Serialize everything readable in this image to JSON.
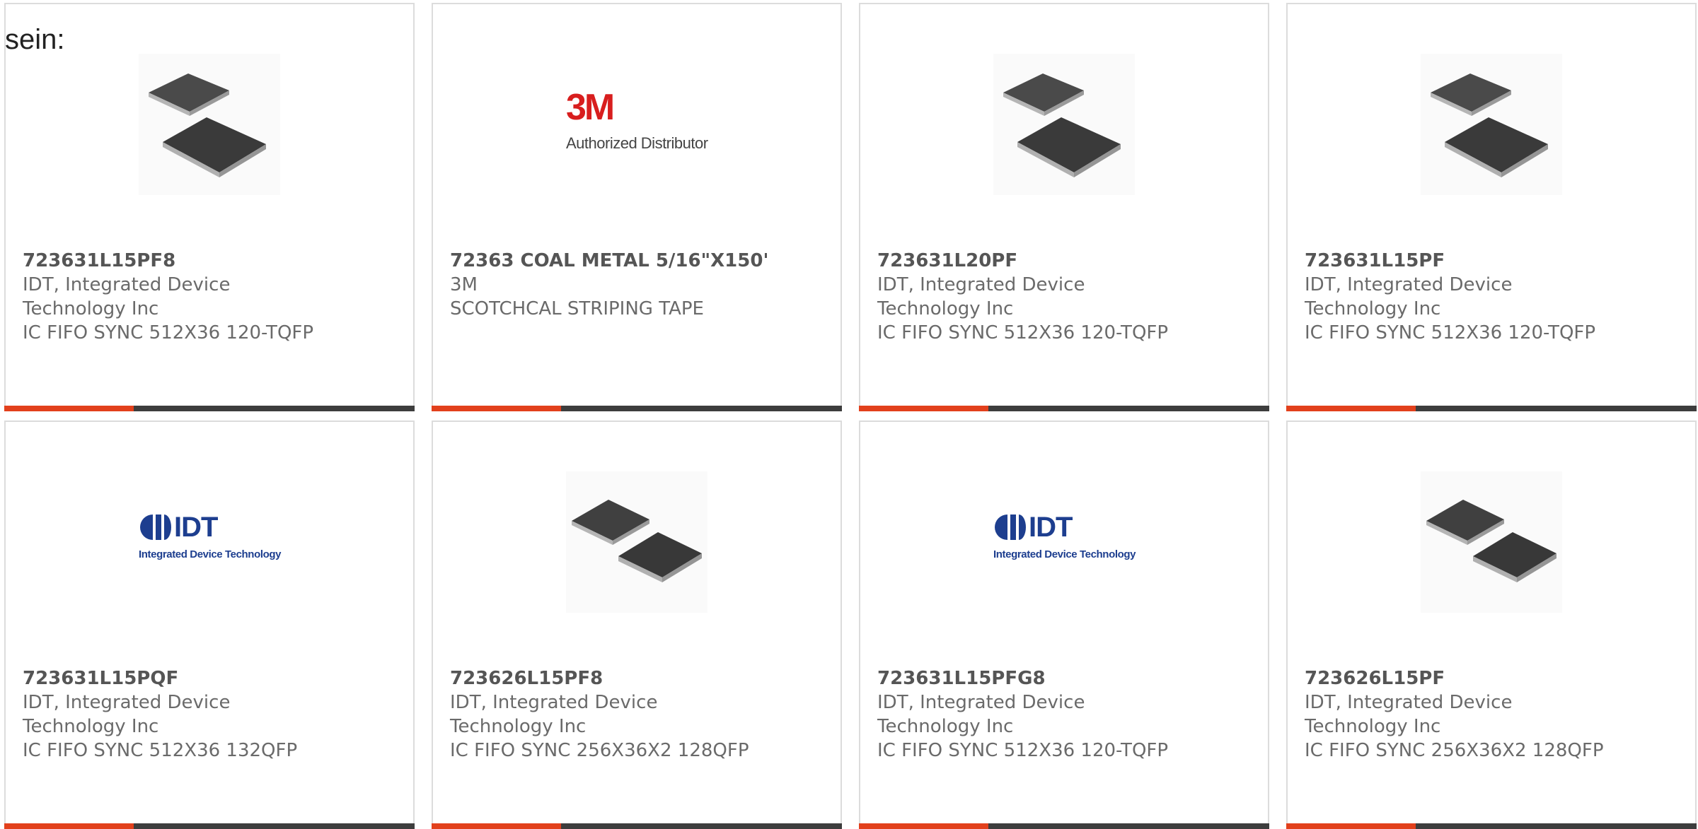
{
  "page": {
    "label": "sein:"
  },
  "products": [
    {
      "part_number": "723631L15PF8",
      "manufacturer": "IDT, Integrated Device Technology Inc",
      "description": "IC FIFO SYNC 512X36 120-TQFP",
      "image": "chip-package-image",
      "image_variant": "stacked"
    },
    {
      "part_number": "72363 COAL METAL 5/16\"X150'",
      "manufacturer": "3M",
      "description": "SCOTCHCAL STRIPING TAPE",
      "image": "3m-logo",
      "logo_text": "3M",
      "logo_subtext": "Authorized Distributor"
    },
    {
      "part_number": "723631L20PF",
      "manufacturer": "IDT, Integrated Device Technology Inc",
      "description": "IC FIFO SYNC 512X36 120-TQFP",
      "image": "chip-package-image",
      "image_variant": "stacked"
    },
    {
      "part_number": "723631L15PF",
      "manufacturer": "IDT, Integrated Device Technology Inc",
      "description": "IC FIFO SYNC 512X36 120-TQFP",
      "image": "chip-package-image",
      "image_variant": "stacked"
    },
    {
      "part_number": "723631L15PQF",
      "manufacturer": "IDT, Integrated Device Technology Inc",
      "description": "IC FIFO SYNC 512X36 132QFP",
      "image": "idt-logo",
      "logo_text": "IDT",
      "logo_subtext": "Integrated Device Technology"
    },
    {
      "part_number": "723626L15PF8",
      "manufacturer": "IDT, Integrated Device Technology Inc",
      "description": "IC FIFO SYNC 256X36X2 128QFP",
      "image": "chip-package-image",
      "image_variant": "side-by-side"
    },
    {
      "part_number": "723631L15PFG8",
      "manufacturer": "IDT, Integrated Device Technology Inc",
      "description": "IC FIFO SYNC 512X36 120-TQFP",
      "image": "idt-logo",
      "logo_text": "IDT",
      "logo_subtext": "Integrated Device Technology"
    },
    {
      "part_number": "723626L15PF",
      "manufacturer": "IDT, Integrated Device Technology Inc",
      "description": "IC FIFO SYNC 256X36X2 128QFP",
      "image": "chip-package-image",
      "image_variant": "side-by-side"
    }
  ],
  "colors": {
    "accent": "#e2401c",
    "bar": "#3d3d3d",
    "border": "#dcdcdc",
    "text": "#6a6a6a",
    "title": "#555555",
    "brand_3m": "#d81e1e",
    "brand_idt": "#1d3e8f"
  }
}
